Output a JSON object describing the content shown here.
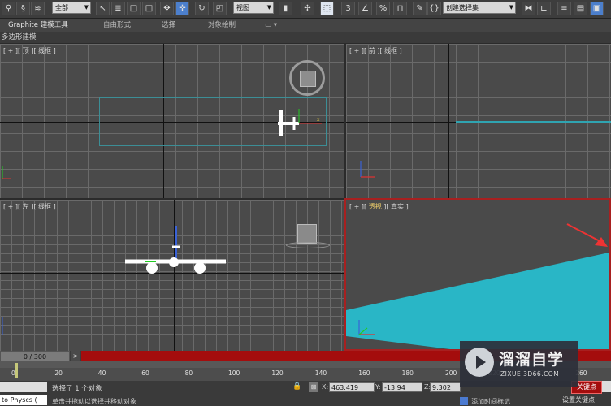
{
  "toolbar": {
    "selection_filter": "全部",
    "ref_coord": "视图",
    "named_selection": "创建选择集",
    "snap_label": "3",
    "angle_snap_label": "%"
  },
  "ribbon": {
    "tabs": [
      "Graphite 建模工具",
      "自由形式",
      "选择",
      "对象绘制"
    ],
    "sub_label": "多边形建模"
  },
  "viewports": {
    "top": "[ + ][ 顶 ][ 线框 ]",
    "front": "[ + ][ 前 ][ 线框 ]",
    "left": "[ + ][ 左 ][ 线框 ]",
    "persp_prefix": "[ + ][ ",
    "persp_name": "透视",
    "persp_suffix": " ][ 真实 ]"
  },
  "timeline": {
    "frame": "0 / 300",
    "ticks": [
      "0",
      "20",
      "40",
      "60",
      "80",
      "100",
      "120",
      "140",
      "160",
      "180",
      "200",
      "220",
      "240",
      "260"
    ]
  },
  "status": {
    "selected_text": "选择了 1 个对象",
    "hint_text": "单击并拖动以选择并移动对象",
    "script_label": "to Physcs (",
    "x_label": "X:",
    "x_value": "463.419",
    "y_label": "Y:",
    "y_value": "-13.94",
    "z_label": "Z:",
    "z_value": "9.302",
    "add_time_tag": "添加时间标记",
    "auto_key": "关键点",
    "set_key": "设置关键点"
  },
  "watermark": {
    "brand": "溜溜自学",
    "url": "ZIXUE.3D66.COM"
  },
  "colors": {
    "accent_red": "#a40d0d",
    "teal_plane": "#29b6c6",
    "viewport_bg": "#4a4a4a"
  }
}
